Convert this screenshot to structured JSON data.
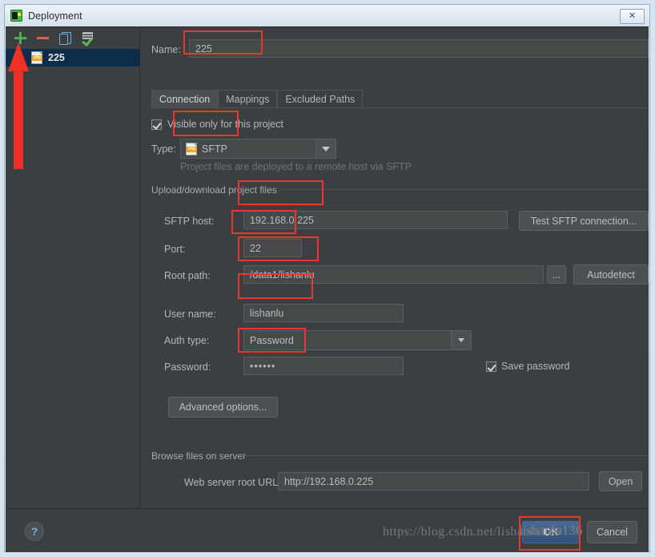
{
  "window": {
    "title": "Deployment",
    "app_icon": "pycharm-icon",
    "close_label": "✕"
  },
  "sidebar": {
    "toolbar": [
      {
        "name": "add-button",
        "icon": "plus-icon",
        "label": "+"
      },
      {
        "name": "remove-button",
        "icon": "minus-icon",
        "label": "−"
      },
      {
        "name": "copy-button",
        "icon": "copy-icon",
        "label": ""
      },
      {
        "name": "set-default-button",
        "icon": "check-list-icon",
        "label": ""
      }
    ],
    "items": [
      {
        "label": "225",
        "icon": "sftp-server-icon",
        "selected": true
      }
    ]
  },
  "form": {
    "name_label": "Name:",
    "name_label_mnemonic": "m",
    "name_value": "225",
    "tabs": [
      {
        "label": "Connection",
        "active": true
      },
      {
        "label": "Mappings",
        "active": false
      },
      {
        "label": "Excluded Paths",
        "active": false
      }
    ],
    "visible_only_checkbox": {
      "label": "Visible only for this project",
      "checked": true
    },
    "type_label": "Type:",
    "type_value": "SFTP",
    "type_icon": "sftp-type-icon",
    "type_hint": "Project files are deployed to a remote host via SFTP",
    "upload_group_title": "Upload/download project files",
    "sftp_host_label": "SFTP host:",
    "sftp_host_value": "192.168.0.225",
    "test_connection_label": "Test SFTP connection...",
    "port_label": "Port:",
    "port_value": "22",
    "root_path_label": "Root path:",
    "root_path_value": "/data1/lishanlu",
    "browse_label": "...",
    "autodetect_label": "Autodetect",
    "user_name_label": "User name:",
    "user_name_value": "lishanlu",
    "auth_type_label": "Auth type:",
    "auth_type_value": "Password",
    "password_label": "Password:",
    "password_value": "••••••",
    "save_password_checkbox": {
      "label": "Save password",
      "checked": true
    },
    "advanced_options_label": "Advanced options...",
    "browse_group_title": "Browse files on server",
    "web_url_label": "Web server root URL:",
    "web_url_value": "http://192.168.0.225",
    "open_label": "Open"
  },
  "footer": {
    "help_label": "?",
    "ok_label": "OK",
    "cancel_label": "Cancel"
  },
  "watermark": {
    "text": "https://blog.csdn.net/lishanlu136",
    "overlay": "lishanlu136"
  },
  "annotation": {
    "color": "#e8382c",
    "arrow": "up-arrow"
  }
}
